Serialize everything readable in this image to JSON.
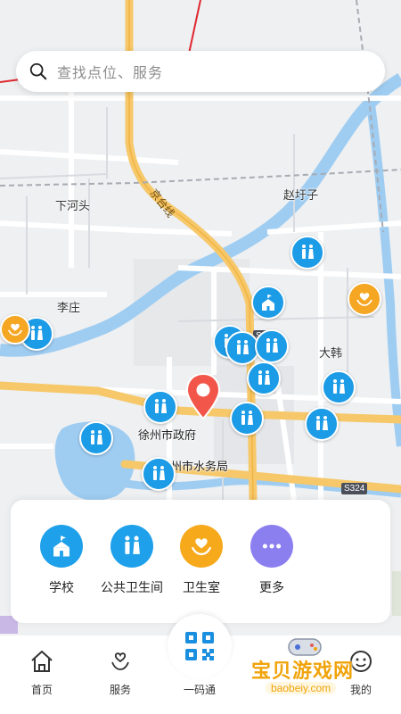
{
  "search": {
    "placeholder": "查找点位、服务"
  },
  "map": {
    "labels": {
      "xiahetou": "下河头",
      "zhaoyuzi": "赵圩子",
      "lizhuang": "李庄",
      "dahan": "大韩",
      "xuzhou_gov": "徐州市政府",
      "water_bureau": "徐州市水务局",
      "road_jingtai": "京台线",
      "shield_s324": "S324",
      "shield_s3": "S3"
    },
    "marker_icons": {
      "toilet": "restroom-icon",
      "school": "school-icon",
      "clinic": "heart-hand-icon"
    }
  },
  "categories": [
    {
      "label": "学校",
      "icon": "school-icon",
      "color": "#1ea0ea"
    },
    {
      "label": "公共卫生间",
      "icon": "restroom-icon",
      "color": "#1ea0ea"
    },
    {
      "label": "卫生室",
      "icon": "heart-hand-icon",
      "color": "#f7a91c"
    },
    {
      "label": "更多",
      "icon": "more-dots-icon",
      "color": "#8b7ff0"
    }
  ],
  "tabs": {
    "home": "首页",
    "service": "服务",
    "code": "一码通",
    "mine": "我的"
  },
  "watermark": {
    "title": "宝贝游戏网",
    "url": "baobeiy.com"
  }
}
